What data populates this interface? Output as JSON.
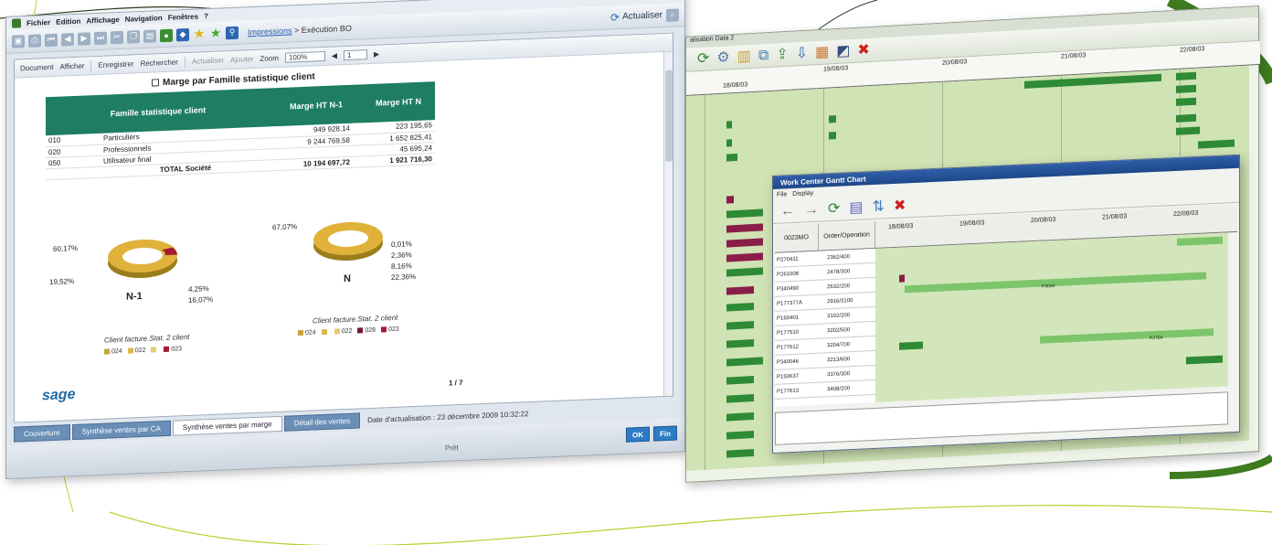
{
  "left_window": {
    "menu": [
      "Fichier",
      "Edition",
      "Affichage",
      "Navigation",
      "Fenêtres",
      "?"
    ],
    "breadcrumb_link": "Impressions",
    "breadcrumb_rest": "> Exécution BO",
    "refresh_label": "Actualiser",
    "doc_toolbar": {
      "document": "Document",
      "afficher": "Afficher",
      "enregistrer": "Enregistrer",
      "rechercher": "Rechercher",
      "actualiser": "Actualiser",
      "ajouter": "Ajouter",
      "zoom_label": "Zoom",
      "zoom_value": "100%",
      "page_value": "1"
    },
    "report": {
      "title": "Marge par Famille statistique client",
      "table": {
        "headers": [
          "Famille statistique client",
          "Marge HT N-1",
          "Marge HT N"
        ],
        "rows": [
          {
            "code": "010",
            "label": "Particuliers",
            "n1": "949 928,14",
            "n": "223 195,65"
          },
          {
            "code": "020",
            "label": "Professionnels",
            "n1": "9 244 769,58",
            "n": "1 652 825,41"
          },
          {
            "code": "050",
            "label": "Utilisateur final",
            "n1": "",
            "n": "45 695,24"
          }
        ],
        "total": {
          "label": "TOTAL Société",
          "n1": "10 194 697,72",
          "n": "1 921 716,30"
        }
      },
      "donut_n1": {
        "name": "N-1",
        "labels": [
          "60,17%",
          "19,52%",
          "4,25%",
          "16,07%"
        ],
        "legend_title": "Client facture.Stat. 2 client",
        "legend": [
          "024",
          "022",
          "",
          "023"
        ]
      },
      "donut_n": {
        "name": "N",
        "labels": [
          "67,07%",
          "0,01%",
          "2,36%",
          "8,16%",
          "22,36%"
        ],
        "legend_title": "Client facture.Stat. 2 client",
        "legend": [
          "024",
          "",
          "022",
          "028",
          "023"
        ]
      },
      "logo": "sage",
      "pager": "1 / 7"
    },
    "tabs": [
      "Couverture",
      "Synthèse ventes par CA",
      "Synthèse ventes par marge",
      "Détail des ventes"
    ],
    "date_label": "Date d'actualisation : 23 décembre 2009 10:32:22",
    "status": "Prêt",
    "ok_label": "OK",
    "fin_label": "Fin"
  },
  "right_window": {
    "title": "alisation Data 2",
    "dates": [
      "18/08/03",
      "19/08/03",
      "20/08/03",
      "21/08/03",
      "22/08/03"
    ]
  },
  "dialog": {
    "title": "Work Center Gantt Chart",
    "menu": [
      "File",
      "Display"
    ],
    "col1": "0023MO",
    "col2": "Order/Operation",
    "dates": [
      "18/08/03",
      "19/08/03",
      "20/08/03",
      "21/08/03",
      "22/08/03"
    ],
    "rows": [
      {
        "mo": "P270411",
        "op": "2362/400"
      },
      {
        "mo": "P261008",
        "op": "2478/300"
      },
      {
        "mo": "P340490",
        "op": "2632/200"
      },
      {
        "mo": "P177377A",
        "op": "2916/3100"
      },
      {
        "mo": "P160401",
        "op": "3102/200"
      },
      {
        "mo": "P177510",
        "op": "3202/500"
      },
      {
        "mo": "P177612",
        "op": "3204/700"
      },
      {
        "mo": "P340046",
        "op": "3213/600"
      },
      {
        "mo": "P150637",
        "op": "3376/300"
      },
      {
        "mo": "P177613",
        "op": "3408/200"
      }
    ],
    "bar_labels": [
      "P3040",
      "P2764"
    ]
  },
  "colors": {
    "brand_green": "#1e7d63",
    "gantt_dark": "#2f8a35",
    "gantt_light": "#7cc56b",
    "gantt_red": "#8a1e48",
    "accent_blue": "#2e7bc4"
  }
}
